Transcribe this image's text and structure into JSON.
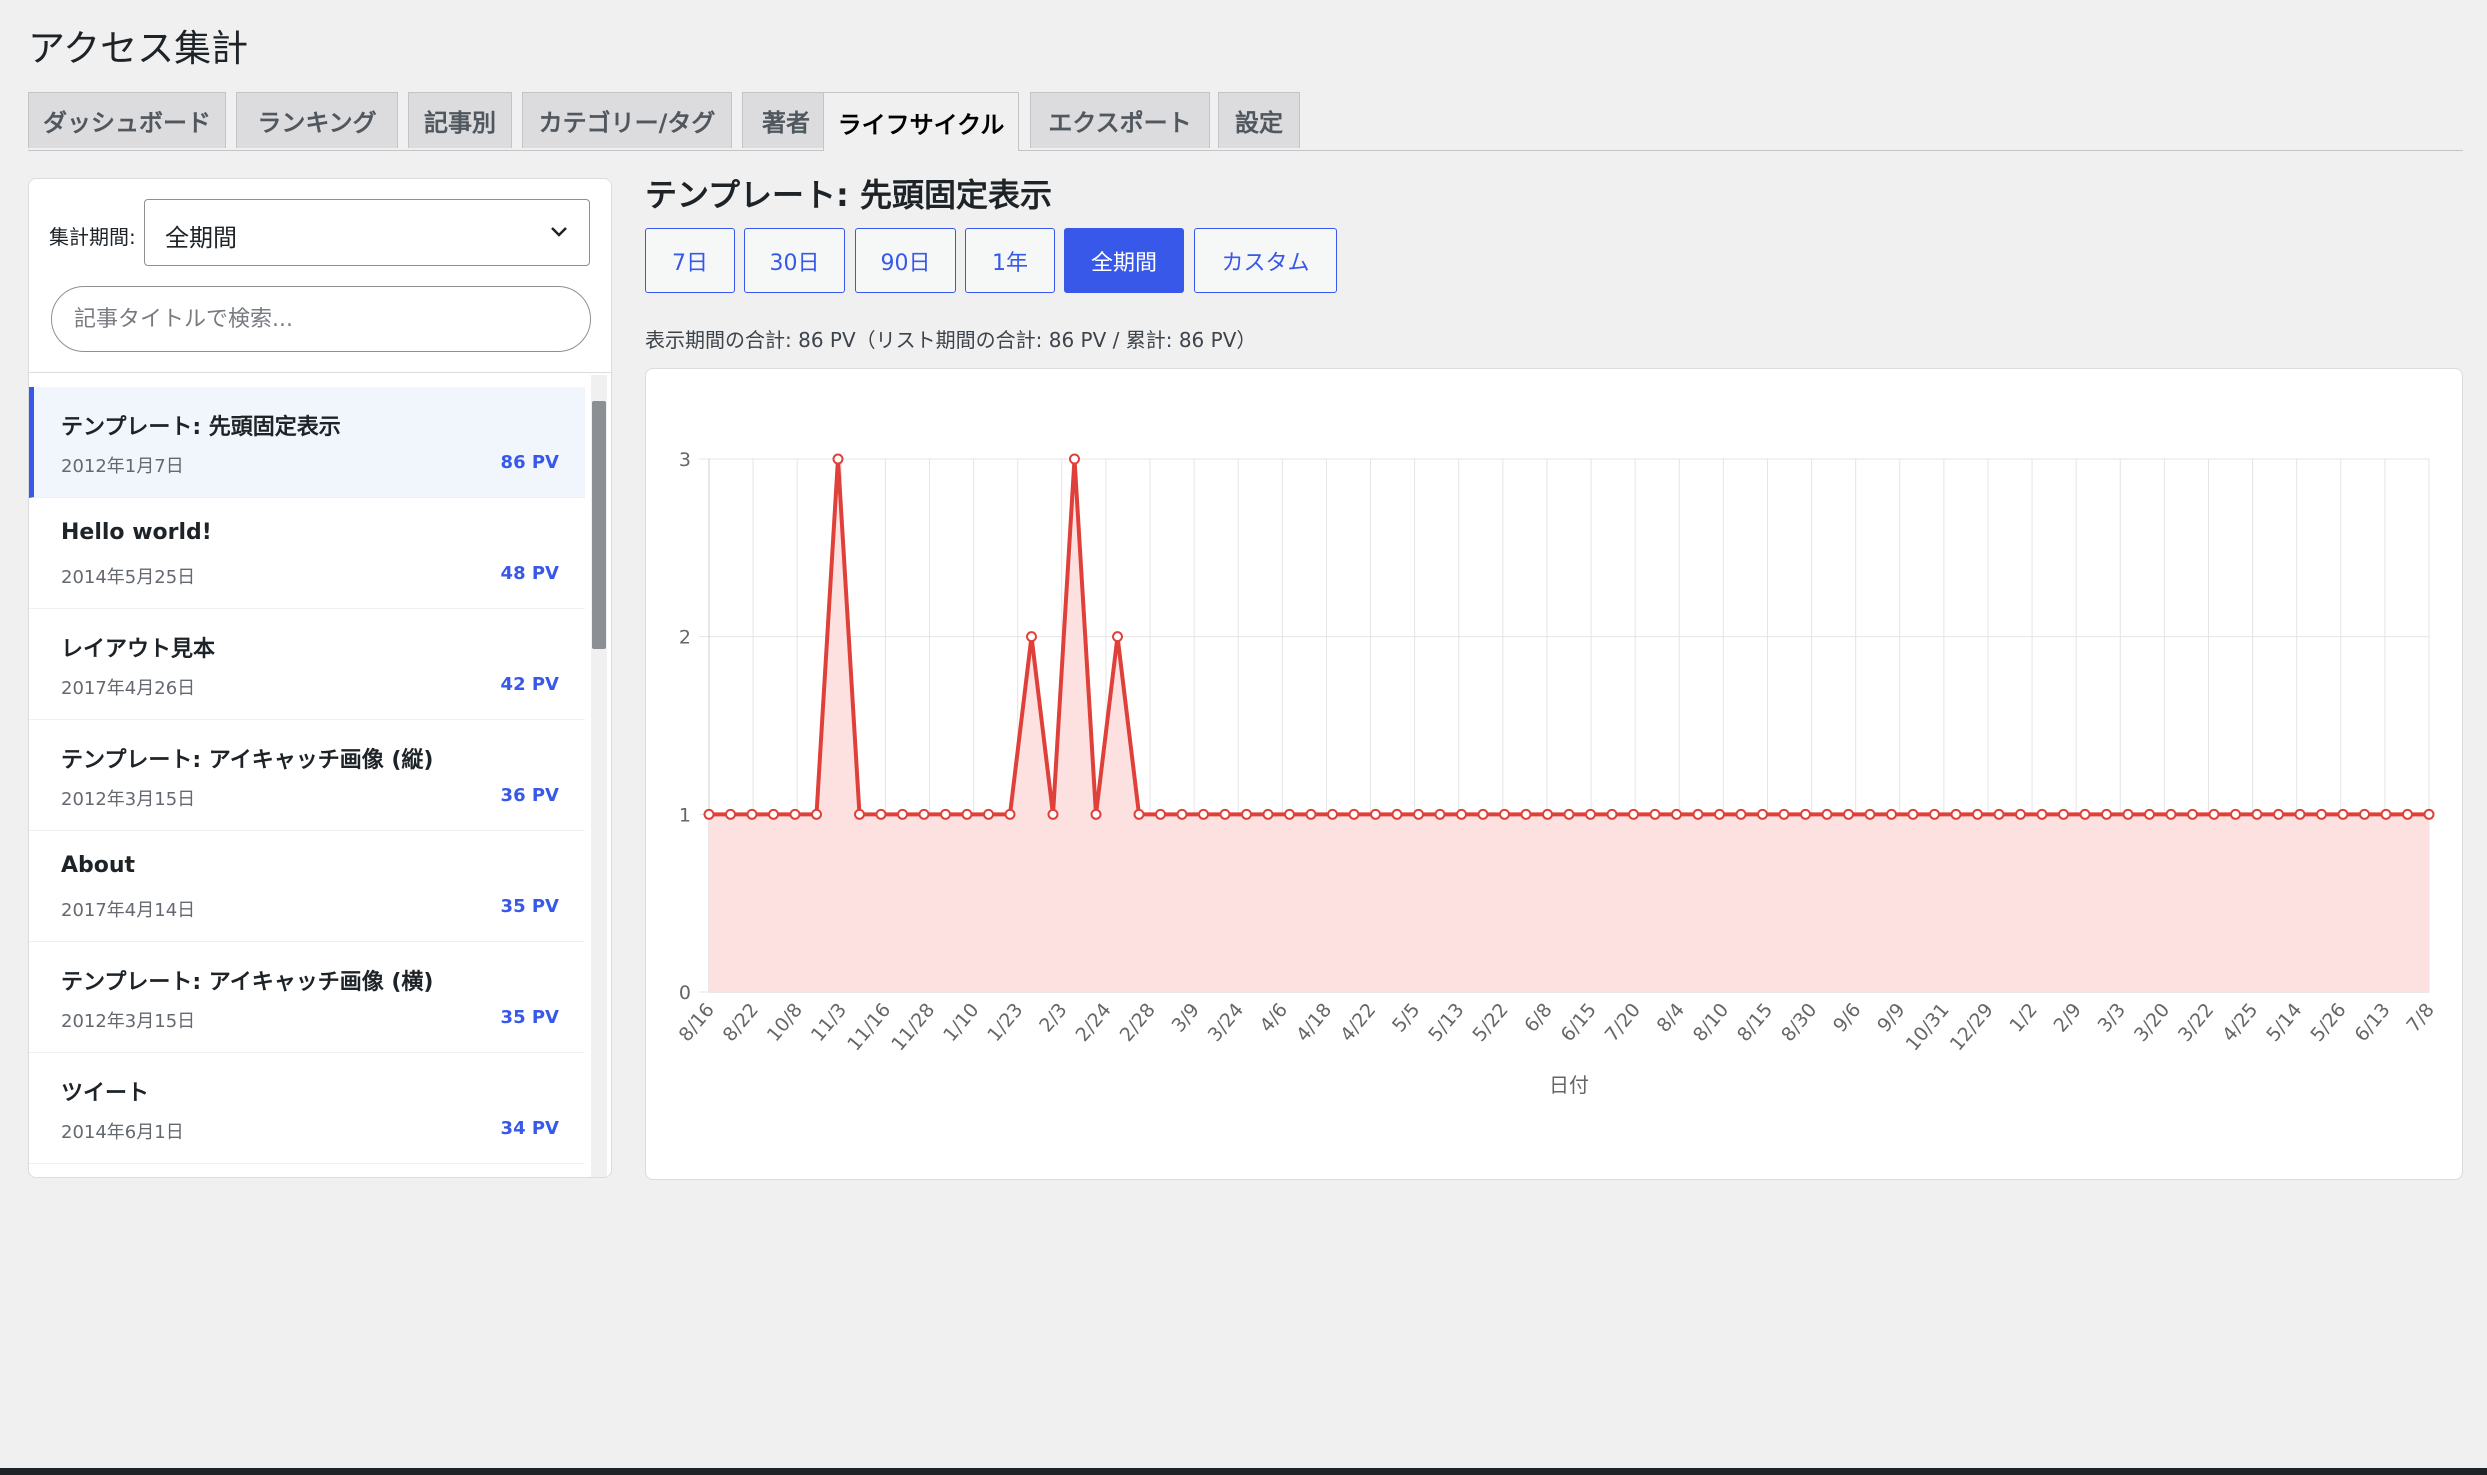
{
  "page": {
    "title": "アクセス集計"
  },
  "tabs": [
    {
      "label": "ダッシュボード",
      "active": false
    },
    {
      "label": "ランキング",
      "active": false
    },
    {
      "label": "記事別",
      "active": false
    },
    {
      "label": "カテゴリー/タグ",
      "active": false
    },
    {
      "label": "著者",
      "active": false
    },
    {
      "label": "ライフサイクル",
      "active": true
    },
    {
      "label": "エクスポート",
      "active": false
    },
    {
      "label": "設定",
      "active": false
    }
  ],
  "sidebar": {
    "period_label": "集計期間:",
    "period_value": "全期間",
    "search_placeholder": "記事タイトルで検索...",
    "posts": [
      {
        "title": "テンプレート: 先頭固定表示",
        "date": "2012年1月7日",
        "pv": "86 PV",
        "selected": true
      },
      {
        "title": "Hello world!",
        "date": "2014年5月25日",
        "pv": "48 PV",
        "selected": false
      },
      {
        "title": "レイアウト見本",
        "date": "2017年4月26日",
        "pv": "42 PV",
        "selected": false
      },
      {
        "title": "テンプレート: アイキャッチ画像 (縦)",
        "date": "2012年3月15日",
        "pv": "36 PV",
        "selected": false
      },
      {
        "title": "About",
        "date": "2017年4月14日",
        "pv": "35 PV",
        "selected": false
      },
      {
        "title": "テンプレート: アイキャッチ画像 (横)",
        "date": "2012年3月15日",
        "pv": "35 PV",
        "selected": false
      },
      {
        "title": "ツイート",
        "date": "2014年6月1日",
        "pv": "34 PV",
        "selected": false
      }
    ]
  },
  "main": {
    "heading": "テンプレート: 先頭固定表示",
    "ranges": [
      {
        "label": "7日",
        "active": false
      },
      {
        "label": "30日",
        "active": false
      },
      {
        "label": "90日",
        "active": false
      },
      {
        "label": "1年",
        "active": false
      },
      {
        "label": "全期間",
        "active": true
      },
      {
        "label": "カスタム",
        "active": false
      }
    ],
    "summary": "表示期間の合計: 86 PV（リスト期間の合計: 86 PV / 累計: 86 PV）"
  },
  "colors": {
    "accent": "#3858e9",
    "line": "#e0403a",
    "fill": "#fde0e0"
  },
  "chart_data": {
    "type": "area",
    "xlabel": "日付",
    "ylabel": "",
    "ylim": [
      0,
      3
    ],
    "yticks": [
      0,
      1,
      2,
      3
    ],
    "grid": true,
    "legend": "none",
    "x_tick_labels": [
      "8/16",
      "8/22",
      "10/8",
      "11/3",
      "11/16",
      "11/28",
      "1/10",
      "1/23",
      "2/3",
      "2/24",
      "2/28",
      "3/9",
      "3/24",
      "4/6",
      "4/18",
      "4/22",
      "5/5",
      "5/13",
      "5/22",
      "6/8",
      "6/15",
      "7/20",
      "8/4",
      "8/10",
      "8/15",
      "8/30",
      "9/6",
      "9/9",
      "10/31",
      "12/29",
      "1/2",
      "2/9",
      "3/3",
      "3/20",
      "3/22",
      "4/25",
      "5/14",
      "5/26",
      "6/13",
      "7/8"
    ],
    "series": [
      {
        "values": [
          1,
          1,
          1,
          1,
          1,
          1,
          3,
          1,
          1,
          1,
          1,
          1,
          1,
          1,
          1,
          2,
          1,
          3,
          1,
          2,
          1,
          1,
          1,
          1,
          1,
          1,
          1,
          1,
          1,
          1,
          1,
          1,
          1,
          1,
          1,
          1,
          1,
          1,
          1,
          1,
          1,
          1,
          1,
          1,
          1,
          1,
          1,
          1,
          1,
          1,
          1,
          1,
          1,
          1,
          1,
          1,
          1,
          1,
          1,
          1,
          1,
          1,
          1,
          1,
          1,
          1,
          1,
          1,
          1,
          1,
          1,
          1,
          1,
          1,
          1,
          1,
          1,
          1,
          1,
          1,
          1
        ]
      }
    ]
  }
}
